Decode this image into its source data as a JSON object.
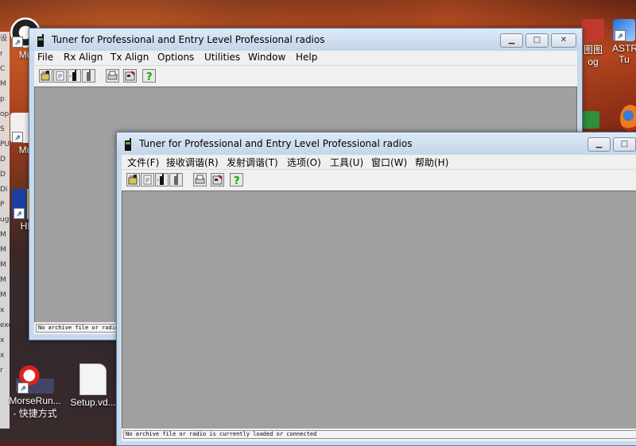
{
  "desktop": {
    "icons": [
      {
        "label": "Mu",
        "icon": "app-shortcut-icon"
      },
      {
        "label": "Mu",
        "icon": "app-shortcut-icon"
      },
      {
        "label": "HE",
        "icon": "app-shortcut-icon"
      },
      {
        "label": "MorseRun...",
        "sublabel": "- 快捷方式",
        "icon": "morserunner-icon"
      },
      {
        "label": "Setup.vd...",
        "icon": "file-icon"
      },
      {
        "label": "图图",
        "sublabel": "og",
        "icon": "app-shortcut-icon"
      },
      {
        "label": "ASTR",
        "sublabel": "Tu",
        "icon": "app-shortcut-icon"
      }
    ],
    "left_strip_chars": [
      "设",
      "r",
      "C",
      "M",
      "p",
      "op",
      "S",
      "PU",
      "D",
      "D",
      "Di",
      "P",
      "ug",
      "M",
      "M",
      "M",
      "M",
      "M",
      "x",
      "exe",
      "x",
      "x",
      "r"
    ]
  },
  "back_window": {
    "title": "Tuner for Professional and Entry Level Professional radios",
    "menu": [
      "File",
      "Rx Align",
      "Tx Align",
      "Options",
      "Utilities",
      "Window",
      "Help"
    ],
    "status": "No archive file or radio is currently loaded or connected",
    "buttons": {
      "minimize": "▁",
      "maximize": "□",
      "close": "✕"
    }
  },
  "front_window": {
    "title": "Tuner for Professional and Entry Level Professional radios",
    "menu": [
      "文件(F)",
      "接收调谐(R)",
      "发射调谐(T)",
      "选项(O)",
      "工具(U)",
      "窗口(W)",
      "帮助(H)"
    ],
    "status": "No archive file or radio is currently loaded or connected",
    "buttons": {
      "minimize": "▁",
      "maximize": "□"
    }
  },
  "toolbar_icons": [
    "open-archive-icon",
    "save-archive-icon",
    "read-radio-icon",
    "write-radio-icon",
    "print-icon",
    "report-icon",
    "help-icon"
  ],
  "colors": {
    "client_bg": "#a0a0a0",
    "window_frame": "#c9d9ec",
    "menu_bg": "#f0f0f0"
  }
}
